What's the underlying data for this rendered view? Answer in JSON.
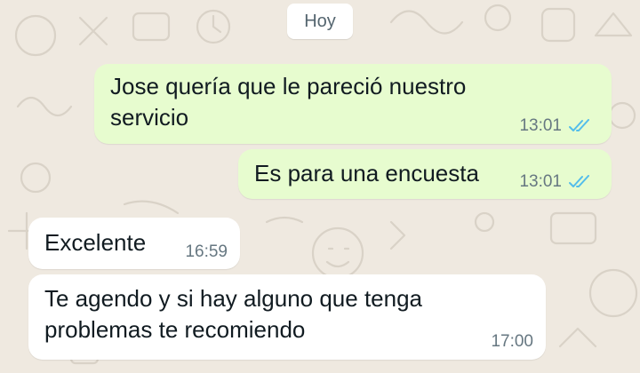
{
  "date_divider": "Hoy",
  "colors": {
    "background": "#efe9e0",
    "outgoing_bubble": "#e7fccf",
    "incoming_bubble": "#ffffff",
    "read_ticks": "#53bdeb",
    "meta_text": "#667781"
  },
  "messages": [
    {
      "direction": "outgoing",
      "text": "Jose quería que le pareció nuestro servicio",
      "time": "13:01",
      "status_icon": "double-check-read-icon"
    },
    {
      "direction": "outgoing",
      "text": "Es para una encuesta",
      "time": "13:01",
      "status_icon": "double-check-read-icon"
    },
    {
      "direction": "incoming",
      "text": "Excelente",
      "time": "16:59"
    },
    {
      "direction": "incoming",
      "text": "Te agendo y si hay alguno que tenga problemas te recomiendo",
      "time": "17:00"
    }
  ]
}
